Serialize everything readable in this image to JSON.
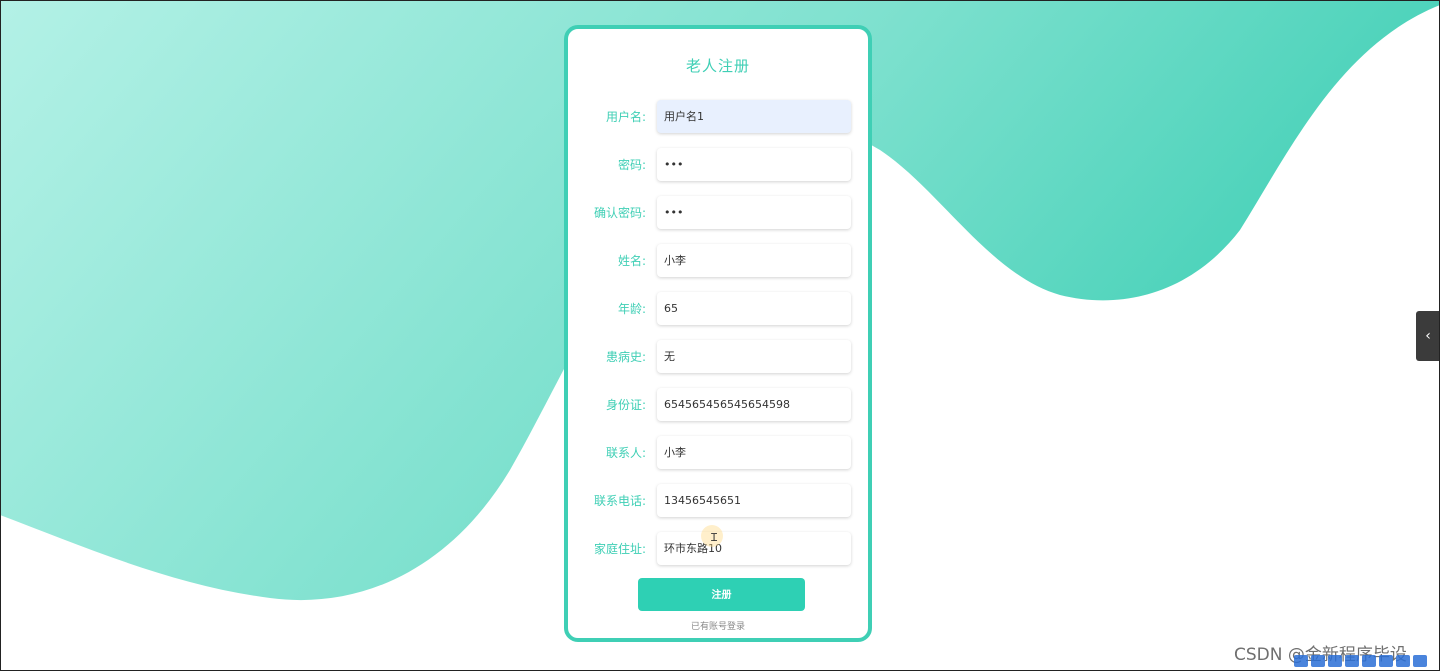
{
  "form": {
    "title": "老人注册",
    "fields": [
      {
        "label": "用户名:",
        "value": "用户名1",
        "type": "text"
      },
      {
        "label": "密码:",
        "value": "•••",
        "type": "password"
      },
      {
        "label": "确认密码:",
        "value": "•••",
        "type": "password"
      },
      {
        "label": "姓名:",
        "value": "小李",
        "type": "text"
      },
      {
        "label": "年龄:",
        "value": "65",
        "type": "text"
      },
      {
        "label": "患病史:",
        "value": "无",
        "type": "text"
      },
      {
        "label": "身份证:",
        "value": "654565456545654598",
        "type": "text"
      },
      {
        "label": "联系人:",
        "value": "小李",
        "type": "text"
      },
      {
        "label": "联系电话:",
        "value": "13456545651",
        "type": "text"
      },
      {
        "label": "家庭住址:",
        "value": "环市东路10",
        "type": "text"
      }
    ],
    "submit_label": "注册",
    "login_link": "已有账号登录"
  },
  "side_toggle": {
    "icon": "chevron-left-icon",
    "glyph": "‹"
  },
  "watermark": "CSDN @金新程序毕设",
  "colors": {
    "accent": "#3fcfb5",
    "button": "#2ed0b4",
    "wave_light": "#b3f1e6",
    "wave_dark": "#3fcfb5"
  }
}
